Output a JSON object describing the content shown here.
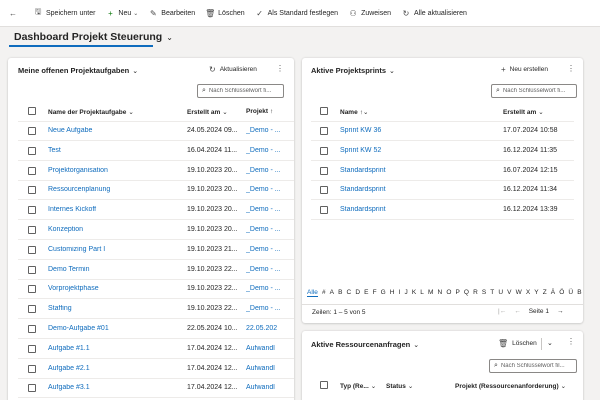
{
  "toolbar": {
    "back_icon": "arrow-left-icon",
    "items": [
      {
        "icon": "save-icon",
        "label": "Speichern unter",
        "caret": false
      },
      {
        "icon": "plus-icon",
        "label": "Neu",
        "caret": true
      },
      {
        "icon": "pencil-icon",
        "label": "Bearbeiten",
        "caret": false
      },
      {
        "icon": "trash-icon",
        "label": "Löschen",
        "caret": false
      },
      {
        "icon": "checkmark-icon",
        "label": "Als Standard festlegen",
        "caret": false
      },
      {
        "icon": "person-icon",
        "label": "Zuweisen",
        "caret": false
      },
      {
        "icon": "refresh-icon",
        "label": "Alle aktualisieren",
        "caret": false
      }
    ]
  },
  "dashboard": {
    "title": "Dashboard Projekt Steuerung"
  },
  "tasks": {
    "title": "Meine offenen Projektaufgaben",
    "refresh_label": "Aktualisieren",
    "search_placeholder": "Nach Schlüsselwort fi...",
    "columns": [
      "Name der Projektaufgabe",
      "Erstellt am",
      "Projekt"
    ],
    "rows": [
      [
        "Neue Aufgabe",
        "24.05.2024 09...",
        "_Demo - ..."
      ],
      [
        "Test",
        "16.04.2024 11...",
        "_Demo - ..."
      ],
      [
        "Projektorganisation",
        "19.10.2023 20...",
        "_Demo - ..."
      ],
      [
        "Ressourcenplanung",
        "19.10.2023 20...",
        "_Demo - ..."
      ],
      [
        "Internes Kickoff",
        "19.10.2023 20...",
        "_Demo - ..."
      ],
      [
        "Konzeption",
        "19.10.2023 20...",
        "_Demo - ..."
      ],
      [
        "Customizing Part I",
        "19.10.2023 21...",
        "_Demo - ..."
      ],
      [
        "Demo Termin",
        "19.10.2023 22...",
        "_Demo - ..."
      ],
      [
        "Vorprojektphase",
        "19.10.2023 22...",
        "_Demo - ..."
      ],
      [
        "Staffing",
        "19.10.2023 22...",
        "_Demo - ..."
      ],
      [
        "Demo-Aufgabe #01",
        "22.05.2024 10...",
        "22.05.202"
      ],
      [
        "Aufgabe #1.1",
        "17.04.2024 12...",
        "Aufwandl"
      ],
      [
        "Aufgabe #2.1",
        "17.04.2024 12...",
        "Aufwandl"
      ],
      [
        "Aufgabe #3.1",
        "17.04.2024 12...",
        "Aufwandl"
      ]
    ]
  },
  "sprints": {
    "title": "Aktive Projektsprints",
    "new_label": "Neu erstellen",
    "search_placeholder": "Nach Schlüsselwort fi...",
    "columns": [
      "Name",
      "Erstellt am"
    ],
    "rows": [
      [
        "Sprint KW 36",
        "17.07.2024 10:58"
      ],
      [
        "Sprint KW 52",
        "16.12.2024 11:35"
      ],
      [
        "Standardsprint",
        "16.07.2024 12:15"
      ],
      [
        "Standardsprint",
        "16.12.2024 11:34"
      ],
      [
        "Standardsprint",
        "16.12.2024 13:39"
      ]
    ],
    "alphabet": [
      "Alle",
      "#",
      "A",
      "B",
      "C",
      "D",
      "E",
      "F",
      "G",
      "H",
      "I",
      "J",
      "K",
      "L",
      "M",
      "N",
      "O",
      "P",
      "Q",
      "R",
      "S",
      "T",
      "U",
      "V",
      "W",
      "X",
      "Y",
      "Z",
      "Ä",
      "Ö",
      "Ü",
      "B"
    ],
    "footer": "Zeilen: 1 – 5 von 5",
    "page_label": "Seite 1"
  },
  "resources": {
    "title": "Aktive Ressourcenanfragen",
    "delete_label": "Löschen",
    "search_placeholder": "Nach Schlüsselwort fil...",
    "columns": [
      "Typ (Re...",
      "Status",
      "Projekt (Ressourcenanforderung)"
    ]
  },
  "colors": {
    "accent": "#0f6cbd",
    "new_icon": "#107c10"
  }
}
